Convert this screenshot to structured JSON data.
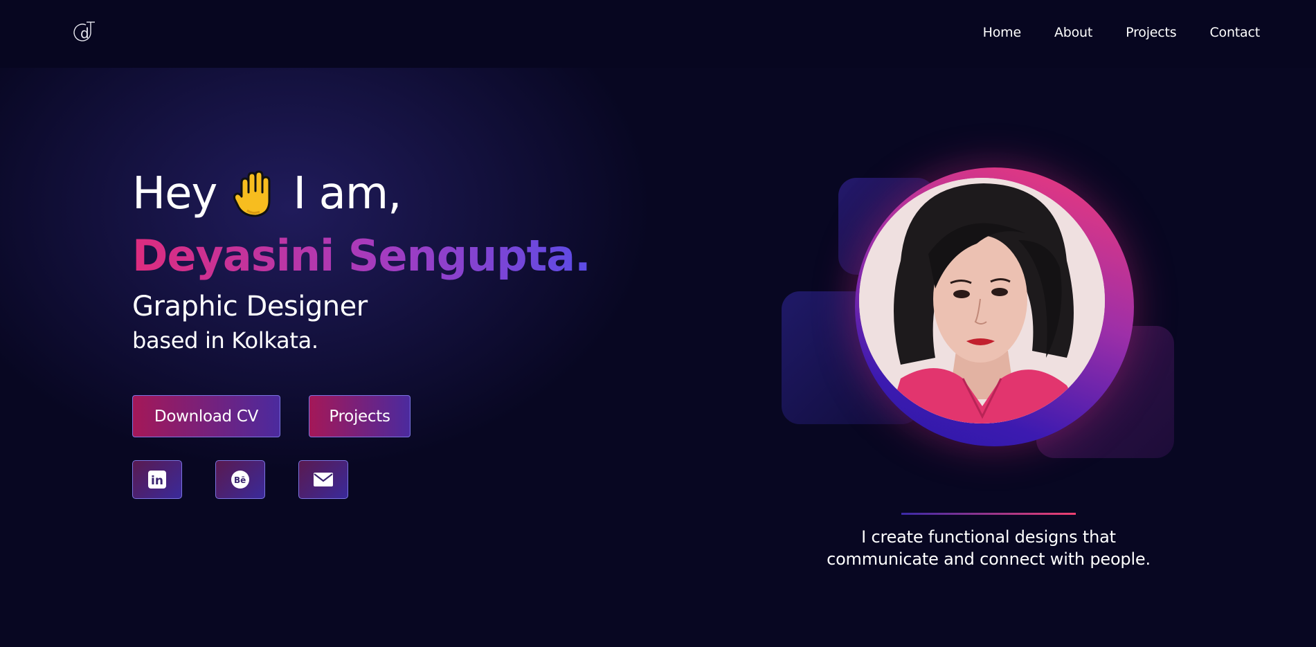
{
  "header": {
    "logo_letter": "d",
    "nav": [
      {
        "label": "Home"
      },
      {
        "label": "About"
      },
      {
        "label": "Projects"
      },
      {
        "label": "Contact"
      }
    ]
  },
  "hero": {
    "greeting_start": "Hey",
    "greeting_end": "I am,",
    "wave_icon": "waving-hand-icon",
    "name": "Deyasini Sengupta.",
    "role": "Graphic Designer",
    "location": "based in Kolkata.",
    "buttons": {
      "download_cv": "Download CV",
      "projects": "Projects"
    },
    "socials": [
      {
        "icon": "linkedin-icon",
        "text": "in"
      },
      {
        "icon": "behance-icon",
        "text": "Bē"
      },
      {
        "icon": "mail-icon"
      }
    ]
  },
  "right": {
    "tagline_line1": "I create functional designs that",
    "tagline_line2": "communicate and connect with people."
  },
  "colors": {
    "background": "#080722",
    "name_gradient_start": "#de2c7e",
    "name_gradient_end": "#5b4ce6",
    "ring_pink": "#f33a78",
    "ring_blue": "#2a18a6"
  }
}
